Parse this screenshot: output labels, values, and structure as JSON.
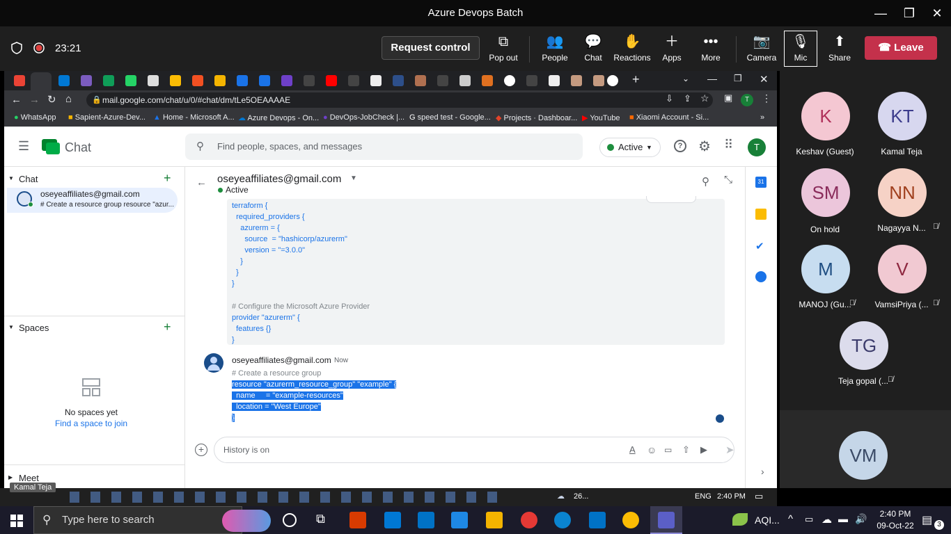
{
  "window": {
    "title": "Azure Devops Batch",
    "minimize": "—",
    "maximize": "❐",
    "close": "✕"
  },
  "meeting": {
    "time": "23:21",
    "request_control": "Request control",
    "buttons": [
      {
        "label": "Pop out",
        "icon": "popout-icon"
      },
      {
        "label": "People",
        "icon": "people-icon"
      },
      {
        "label": "Chat",
        "icon": "chat-icon"
      },
      {
        "label": "Reactions",
        "icon": "reactions-icon"
      },
      {
        "label": "Apps",
        "icon": "apps-icon"
      },
      {
        "label": "More",
        "icon": "more-icon"
      },
      {
        "label": "Camera",
        "icon": "camera-off-icon"
      },
      {
        "label": "Mic",
        "icon": "mic-off-icon"
      },
      {
        "label": "Share",
        "icon": "share-icon"
      }
    ],
    "leave": "Leave"
  },
  "browser": {
    "url": "mail.google.com/chat/u/0/#chat/dm/tLe5OEAAAAE",
    "profile_initial": "T",
    "bookmarks": [
      "WhatsApp",
      "Sapient-Azure-Dev...",
      "Home - Microsoft A...",
      "Azure Devops - On...",
      "DevOps-JobCheck |...",
      "speed test - Google...",
      "Projects · Dashboar...",
      "YouTube",
      "Xiaomi Account - Si..."
    ]
  },
  "gchat": {
    "app_name": "Chat",
    "search_placeholder": "Find people, spaces, and messages",
    "status": "Active",
    "avatar_initial": "T",
    "sidebar": {
      "chat_header": "Chat",
      "dm_name": "oseyeaffiliates@gmail.com",
      "dm_preview": "# Create a resource group resource \"azur...",
      "spaces_header": "Spaces",
      "no_spaces": "No spaces yet",
      "find_space": "Find a space to join",
      "meet_header": "Meet",
      "tooltip": "Kamal Teja"
    },
    "conversation": {
      "contact": "oseyeaffiliates@gmail.com",
      "contact_status": "Active",
      "code_lines": [
        "terraform {",
        "  required_providers {",
        "    azurerm = {",
        "      source  = \"hashicorp/azurerm\"",
        "      version = \"=3.0.0\"",
        "    }",
        "  }",
        "}",
        "",
        "# Configure the Microsoft Azure Provider",
        "provider \"azurerm\" {",
        "  features {}",
        "}"
      ],
      "sender": "oseyeaffiliates@gmail.com",
      "sent_time": "Now",
      "msg_comment": "# Create a resource group",
      "msg_lines": [
        "resource \"azurerm_resource_group\" \"example\" {",
        "  name     = \"example-resources\"",
        "  location = \"West Europe\"",
        "}"
      ],
      "composer_placeholder": "History is on"
    }
  },
  "participants": [
    {
      "initials": "K",
      "name": "Keshav (Guest)",
      "bg": "#f4c7d2",
      "fg": "#b0305a",
      "muted": false
    },
    {
      "initials": "KT",
      "name": "Kamal Teja",
      "bg": "#d7d7ef",
      "fg": "#3c3c8c",
      "muted": false
    },
    {
      "initials": "SM",
      "name": "On hold",
      "bg": "#ecc6db",
      "fg": "#8a2c5b",
      "muted": false
    },
    {
      "initials": "NN",
      "name": "Nagayya N...",
      "bg": "#f6d2c6",
      "fg": "#a0401e",
      "muted": true
    },
    {
      "initials": "M",
      "name": "MANOJ (Gu...",
      "bg": "#c7ddf0",
      "fg": "#1f4e82",
      "muted": true
    },
    {
      "initials": "V",
      "name": "VamsiPriya (...",
      "bg": "#f1c9d2",
      "fg": "#8e2840",
      "muted": true
    },
    {
      "initials": "TG",
      "name": "Teja gopal (...",
      "bg": "#dcdcec",
      "fg": "#3c3c6c",
      "muted": true
    }
  ],
  "self_tile": {
    "initials": "VM",
    "bg": "#c5d6e8",
    "fg": "#3a4a66"
  },
  "inner_taskbar": {
    "weather": "26...",
    "lang": "ENG",
    "clock": "2:40 PM"
  },
  "taskbar": {
    "search_placeholder": "Type here to search",
    "weather": "AQI...",
    "time": "2:40 PM",
    "date": "09-Oct-22",
    "notifications": "3"
  }
}
